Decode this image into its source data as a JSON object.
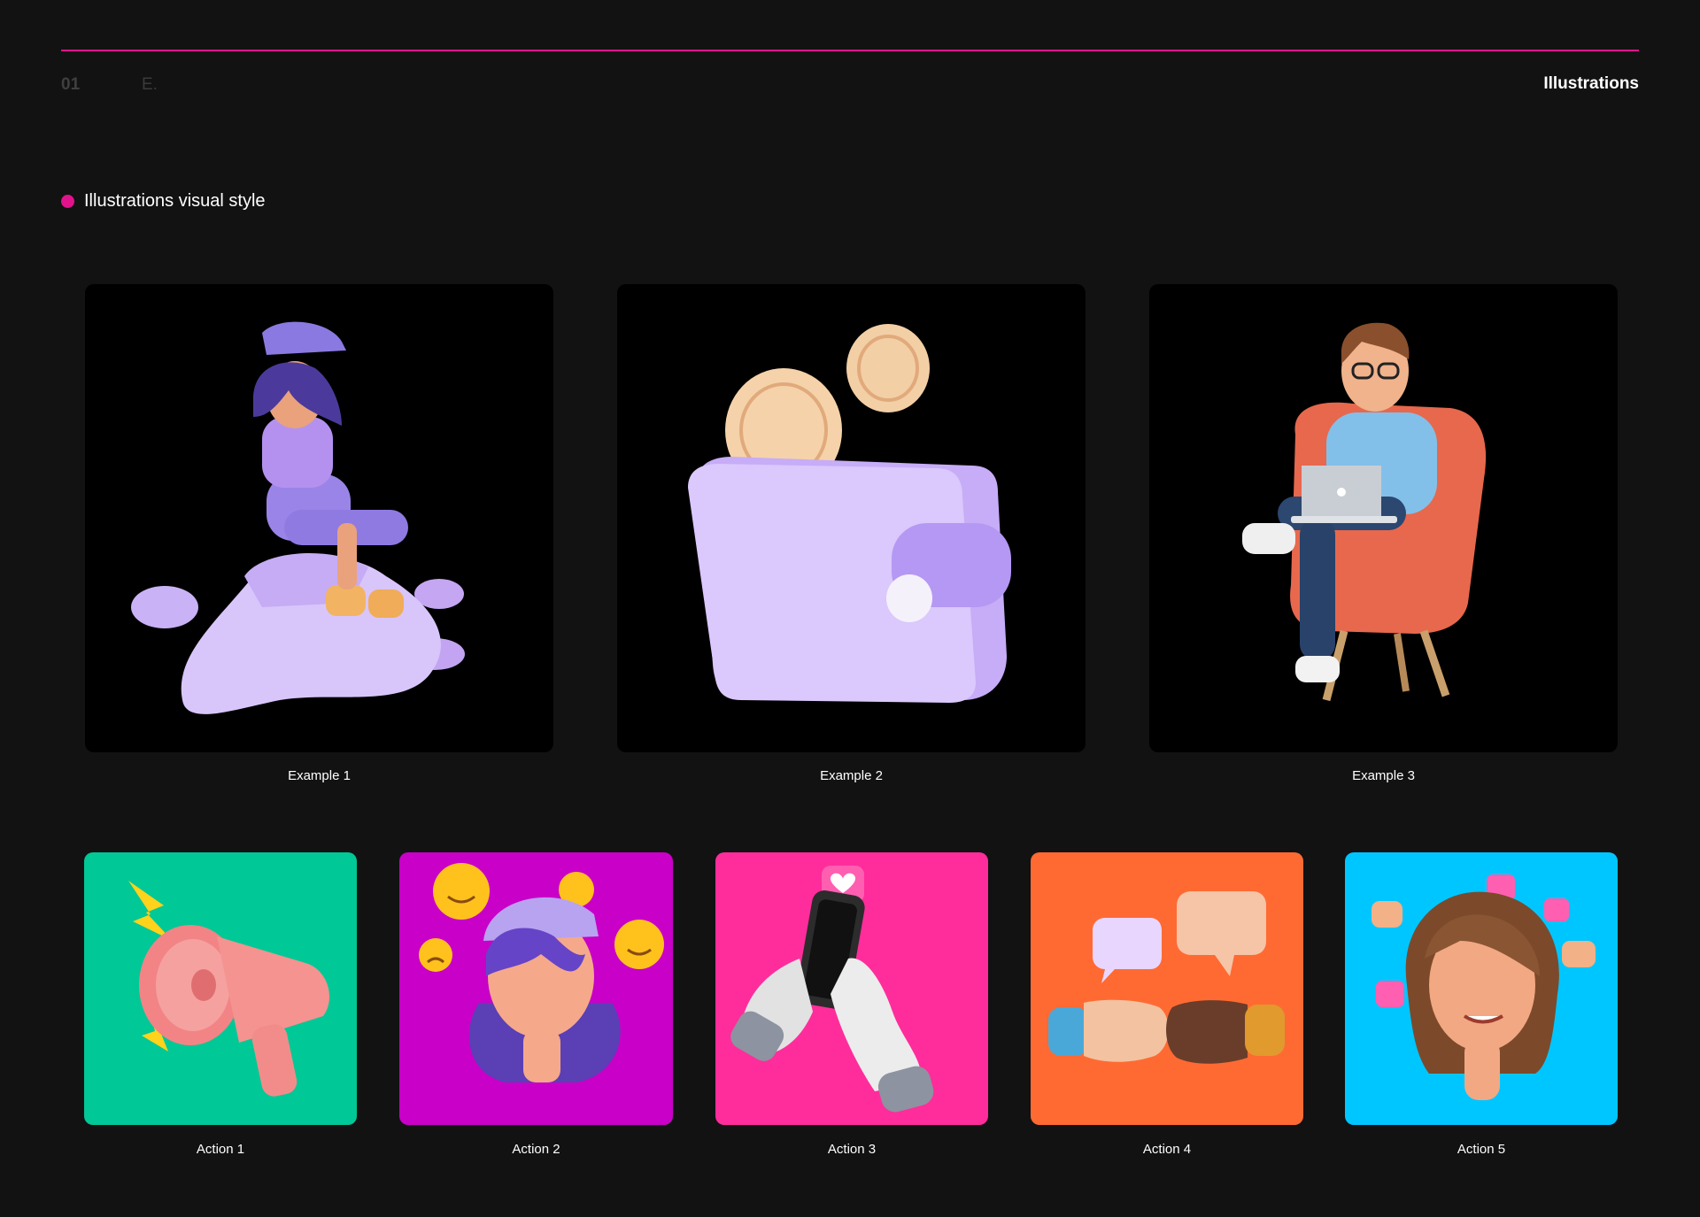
{
  "header": {
    "page_number": "01",
    "brand_mark": "E.",
    "section_title": "Illustrations",
    "accent_color": "#e0138c"
  },
  "subhead": {
    "label": "Illustrations visual style"
  },
  "examples": [
    {
      "caption": "Example 1",
      "image": "girl-sitting-on-blob-illustration",
      "bg": "#000000"
    },
    {
      "caption": "Example 2",
      "image": "wallet-with-coins-illustration",
      "bg": "#000000"
    },
    {
      "caption": "Example 3",
      "image": "man-in-armchair-with-laptop-illustration",
      "bg": "#000000"
    }
  ],
  "actions": [
    {
      "caption": "Action 1",
      "image": "megaphone-illustration",
      "bg": "#00c896"
    },
    {
      "caption": "Action 2",
      "image": "girl-with-emojis-illustration",
      "bg": "#c800c8"
    },
    {
      "caption": "Action 3",
      "image": "hands-with-phone-illustration",
      "bg": "#ff2d9b"
    },
    {
      "caption": "Action 4",
      "image": "fist-bump-illustration",
      "bg": "#ff6a33"
    },
    {
      "caption": "Action 5",
      "image": "woman-with-likes-illustration",
      "bg": "#00c6ff"
    }
  ]
}
